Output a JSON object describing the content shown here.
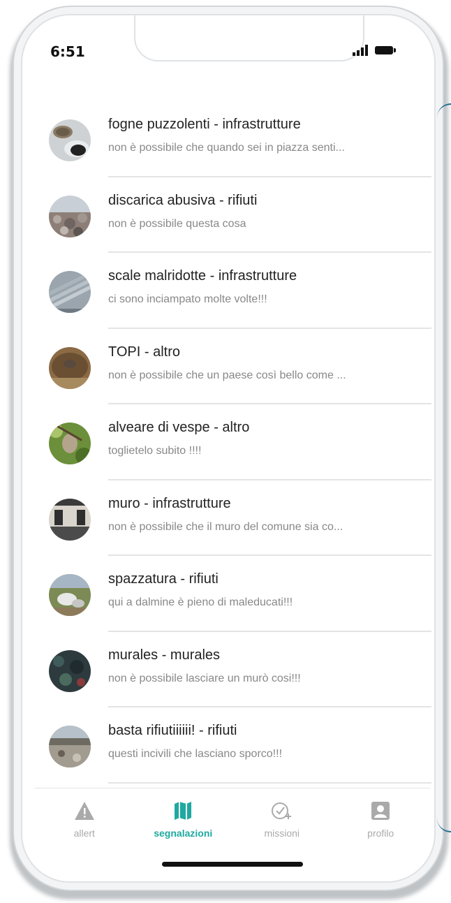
{
  "status": {
    "time": "6:51"
  },
  "reports": [
    {
      "title": "fogne puzzolenti - infrastrutture",
      "description": "non è possibile che quando sei in piazza senti...",
      "image": "sewer-thumb"
    },
    {
      "title": "discarica abusiva - rifiuti",
      "description": "non è possibile questa cosa",
      "image": "dump-thumb"
    },
    {
      "title": "scale malridotte - infrastrutture",
      "description": "ci sono inciampato molte volte!!!",
      "image": "stairs-thumb"
    },
    {
      "title": "TOPI - altro",
      "description": "non è possibile che un paese così bello come ...",
      "image": "rat-thumb"
    },
    {
      "title": "alveare di vespe - altro",
      "description": "toglietelo subito !!!!",
      "image": "wasp-nest-thumb"
    },
    {
      "title": "muro - infrastrutture",
      "description": "non è possibile che il muro del comune sia co...",
      "image": "wall-thumb"
    },
    {
      "title": "spazzatura - rifiuti",
      "description": "qui a dalmine è pieno di maleducati!!!",
      "image": "trash-thumb"
    },
    {
      "title": "murales - murales",
      "description": "non è possibile lasciare un murò cosi!!!",
      "image": "mural-thumb"
    },
    {
      "title": "basta rifiutiiiiii! - rifiuti",
      "description": "questi incivili che lasciano sporco!!!",
      "image": "garbage-thumb"
    }
  ],
  "tabs": [
    {
      "label": "allert",
      "icon": "warning-icon"
    },
    {
      "label": "segnalazioni",
      "icon": "map-icon"
    },
    {
      "label": "missioni",
      "icon": "check-plus-icon"
    },
    {
      "label": "profilo",
      "icon": "profile-icon"
    }
  ],
  "colors": {
    "accent": "#1fa9a0",
    "inactive": "#aaaaaa"
  }
}
